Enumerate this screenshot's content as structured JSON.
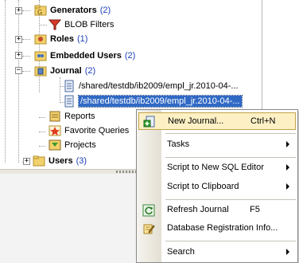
{
  "tree": {
    "items": [
      {
        "label": "Generators",
        "count": "(2)",
        "bold": true
      },
      {
        "label": "BLOB Filters",
        "count": "",
        "bold": false
      },
      {
        "label": "Roles",
        "count": "(1)",
        "bold": true
      },
      {
        "label": "Embedded Users",
        "count": "(2)",
        "bold": true
      },
      {
        "label": "Journal",
        "count": "(2)",
        "bold": true
      },
      {
        "label": "/shared/testdb/ib2009/empl_jr.2010-04-...",
        "count": "",
        "bold": false
      },
      {
        "label": "/shared/testdb/ib2009/empl_jr.2010-04-...",
        "count": "",
        "bold": false
      },
      {
        "label": "Reports",
        "count": "",
        "bold": false
      },
      {
        "label": "Favorite Queries",
        "count": "",
        "bold": false
      },
      {
        "label": "Projects",
        "count": "",
        "bold": false
      },
      {
        "label": "Users",
        "count": "(3)",
        "bold": true
      }
    ]
  },
  "context_menu": {
    "new_journal": {
      "label": "New Journal...",
      "shortcut": "Ctrl+N"
    },
    "tasks": {
      "label": "Tasks"
    },
    "script_sql_editor": {
      "label": "Script to New SQL Editor"
    },
    "script_clipboard": {
      "label": "Script to Clipboard"
    },
    "refresh_journal": {
      "label": "Refresh Journal",
      "shortcut": "F5"
    },
    "db_registration": {
      "label": "Database Registration Info..."
    },
    "search": {
      "label": "Search"
    }
  },
  "colors": {
    "selection": "#316ac5",
    "count_text": "#1a3fbd",
    "menu_highlight": "#fdf0c4"
  }
}
